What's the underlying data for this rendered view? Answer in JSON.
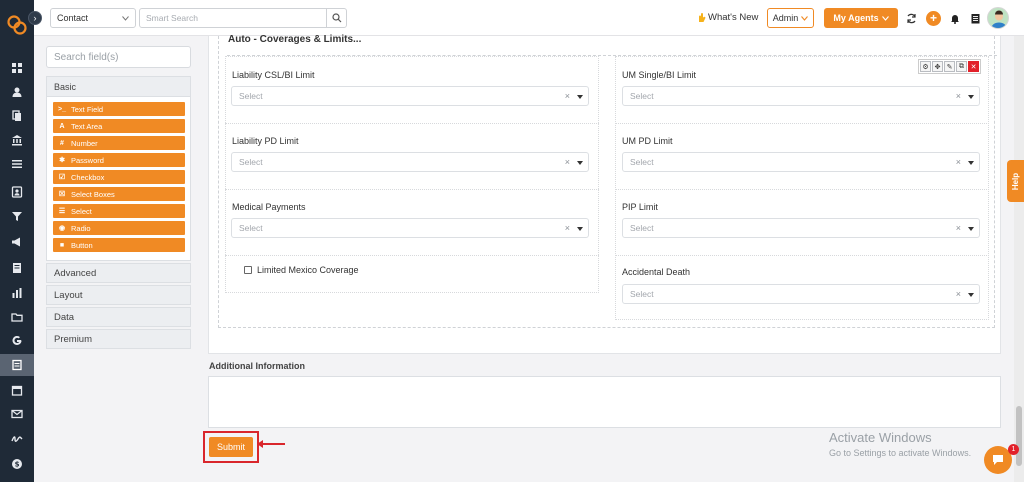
{
  "topbar": {
    "contact_label": "Contact",
    "search_placeholder": "Smart Search",
    "whats_new": "What's New",
    "admin_label": "Admin",
    "my_agents_label": "My Agents"
  },
  "builder": {
    "search_placeholder": "Search field(s)",
    "basic_label": "Basic",
    "components": [
      {
        "glyph": ">_",
        "label": "Text Field"
      },
      {
        "glyph": "A",
        "label": "Text Area"
      },
      {
        "glyph": "#",
        "label": "Number"
      },
      {
        "glyph": "✱",
        "label": "Password"
      },
      {
        "glyph": "☑",
        "label": "Checkbox"
      },
      {
        "glyph": "☒",
        "label": "Select Boxes"
      },
      {
        "glyph": "☰",
        "label": "Select"
      },
      {
        "glyph": "◉",
        "label": "Radio"
      },
      {
        "glyph": "■",
        "label": "Button"
      }
    ],
    "advanced_label": "Advanced",
    "layout_label": "Layout",
    "data_label": "Data",
    "premium_label": "Premium"
  },
  "form": {
    "section_title": "Auto - Coverages & Limits...",
    "left": {
      "liability_csl": {
        "label": "Liability CSL/BI Limit",
        "placeholder": "Select"
      },
      "liability_pd": {
        "label": "Liability PD Limit",
        "placeholder": "Select"
      },
      "medical_payments": {
        "label": "Medical Payments",
        "placeholder": "Select"
      },
      "limited_mexico": {
        "label": "Limited Mexico Coverage"
      }
    },
    "right": {
      "um_single": {
        "label": "UM Single/BI Limit",
        "placeholder": "Select"
      },
      "um_pd": {
        "label": "UM PD Limit",
        "placeholder": "Select"
      },
      "pip": {
        "label": "PIP Limit",
        "placeholder": "Select"
      },
      "accidental_death": {
        "label": "Accidental Death",
        "placeholder": "Select"
      }
    },
    "clear_glyph": "×",
    "additional_info_label": "Additional Information",
    "submit_label": "Submit"
  },
  "watermark": {
    "line1": "Activate Windows",
    "line2": "Go to Settings to activate Windows."
  },
  "help_label": "Help",
  "chat_badge_count": "1",
  "colors": {
    "accent": "#f08a24",
    "rail": "#1f2a37",
    "danger": "#e2212a"
  }
}
